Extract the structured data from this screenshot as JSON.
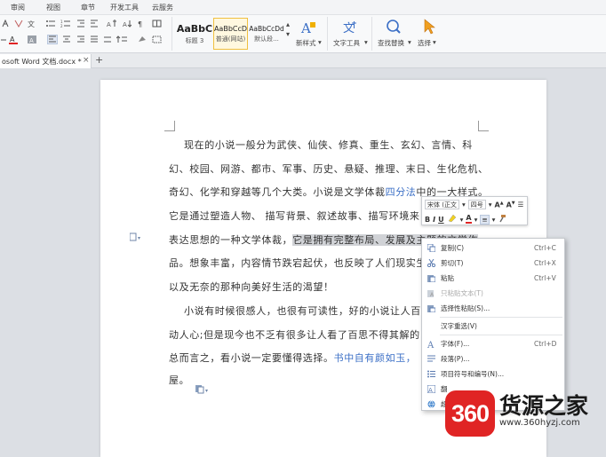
{
  "ribbon_tabs": [
    "审阅",
    "视图",
    "章节",
    "开发工具",
    "云服务"
  ],
  "styles": [
    {
      "sample": "AaBbC",
      "label": "标题 3"
    },
    {
      "sample": "AaBbCcD",
      "label": "普通(网站)"
    },
    {
      "sample": "AaBbCcDd",
      "label": "默认段..."
    }
  ],
  "ribbon_buttons": {
    "new_style": "新样式",
    "text_tools": "文字工具",
    "find_replace": "查找替换",
    "select": "选择"
  },
  "document_tab": {
    "title": "osoft Word 文档.docx *",
    "close": "×",
    "new": "+"
  },
  "document": {
    "lines": [
      "现在的小说一般分为武侠、仙侠、修真、重生、玄幻、言情、科",
      "幻、校园、网游、都市、军事、历史、悬疑、推理、末日、生化危机、",
      "奇幻、化学和穿越等几个大类。小说是文学体裁",
      "它是通过塑造人物、 描写背景、叙述故事、描写环境来",
      "表达思想的一种文学体裁，",
      "品。想象丰富，内容情节跌宕起伏，也反映了人们现实生",
      "以及无奈的那种向美好生活的渴望！",
      "小说有时候很感人，也很有可读性，好的小说让人百",
      "动人心;但是现今也不乏有很多让人看了百思不得其解的",
      "总而言之，看小说一定要懂得选择。",
      "屋。"
    ],
    "line3_link": "四分法",
    "line3_tail": "中的一大样式。",
    "line5_selected": "它是拥有完整布局、发展及主题的文学作",
    "line10_link": "书中自有颜如玉，"
  },
  "mini_toolbar": {
    "font": "宋体 (正文",
    "size": "四号",
    "bold": "B",
    "italic": "I",
    "underline": "U",
    "font_color": "A"
  },
  "context_menu": [
    {
      "label": "复制(C)",
      "shortcut": "Ctrl+C",
      "icon": "copy-icon",
      "disabled": false
    },
    {
      "label": "剪切(T)",
      "shortcut": "Ctrl+X",
      "icon": "cut-icon",
      "disabled": false
    },
    {
      "label": "粘贴",
      "shortcut": "Ctrl+V",
      "icon": "paste-icon",
      "disabled": false
    },
    {
      "label": "只粘贴文本(T)",
      "shortcut": "",
      "icon": "paste-text-icon",
      "disabled": true
    },
    {
      "label": "选择性粘贴(S)...",
      "shortcut": "",
      "icon": "paste-special-icon",
      "disabled": false
    },
    {
      "label": "汉字重选(V)",
      "shortcut": "",
      "icon": "",
      "disabled": false
    },
    {
      "label": "字体(F)...",
      "shortcut": "Ctrl+D",
      "icon": "font-icon",
      "disabled": false
    },
    {
      "label": "段落(P)...",
      "shortcut": "",
      "icon": "paragraph-icon",
      "disabled": false
    },
    {
      "label": "项目符号和编号(N)...",
      "shortcut": "",
      "icon": "bullets-icon",
      "disabled": false
    },
    {
      "label": "翻",
      "shortcut": "",
      "icon": "translate-icon",
      "disabled": false
    },
    {
      "label": "超",
      "shortcut": "",
      "icon": "hyperlink-icon",
      "disabled": false
    }
  ],
  "watermark": {
    "badge": "360",
    "title": "货源之家",
    "url": "www.360hyzj.com"
  },
  "colors": {
    "accent_blue": "#3b6fc6",
    "selection": "#d0d2d6",
    "brand_red": "#e02424"
  }
}
